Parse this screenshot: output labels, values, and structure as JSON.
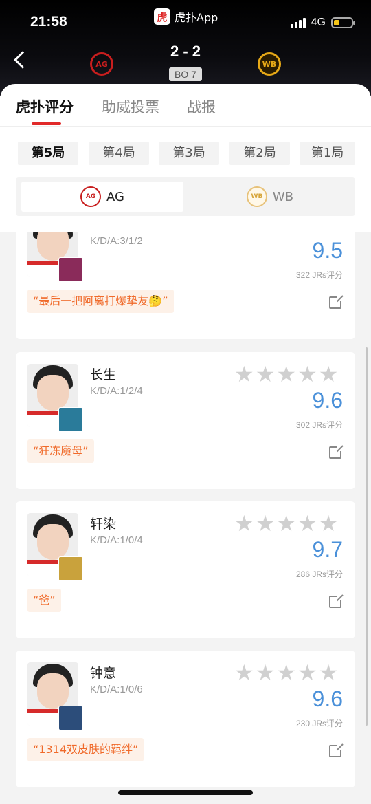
{
  "status": {
    "time": "21:58",
    "network": "4G",
    "app_name": "虎扑App",
    "app_logo_text": "虎"
  },
  "match": {
    "score": "2 - 2",
    "format": "BO 7",
    "team_left_logo": "AG",
    "team_right_logo": "WB"
  },
  "tabs": [
    {
      "label": "虎扑评分"
    },
    {
      "label": "助威投票"
    },
    {
      "label": "战报"
    }
  ],
  "games": [
    {
      "label": "第5局"
    },
    {
      "label": "第4局"
    },
    {
      "label": "第3局"
    },
    {
      "label": "第2局"
    },
    {
      "label": "第1局"
    }
  ],
  "teams": [
    {
      "name": "AG",
      "logo_text": "AG"
    },
    {
      "name": "WB",
      "logo_text": "WB"
    }
  ],
  "players": [
    {
      "name": "",
      "kda": "K/D/A:3/1/2",
      "rating": "9.5",
      "votes": "322 JRs评分",
      "quote": "“最后一把阿离打爆挚友🤔”",
      "hero_color": "#8a2b5a"
    },
    {
      "name": "长生",
      "kda": "K/D/A:1/2/4",
      "rating": "9.6",
      "votes": "302 JRs评分",
      "quote": "“狂冻魔母”",
      "hero_color": "#2a7b9a"
    },
    {
      "name": "轩染",
      "kda": "K/D/A:1/0/4",
      "rating": "9.7",
      "votes": "286 JRs评分",
      "quote": "“爸”",
      "hero_color": "#c9a23c"
    },
    {
      "name": "钟意",
      "kda": "K/D/A:1/0/6",
      "rating": "9.6",
      "votes": "230 JRs评分",
      "quote": "“1314双皮肤的羁绊”",
      "hero_color": "#2c4d7a"
    }
  ]
}
